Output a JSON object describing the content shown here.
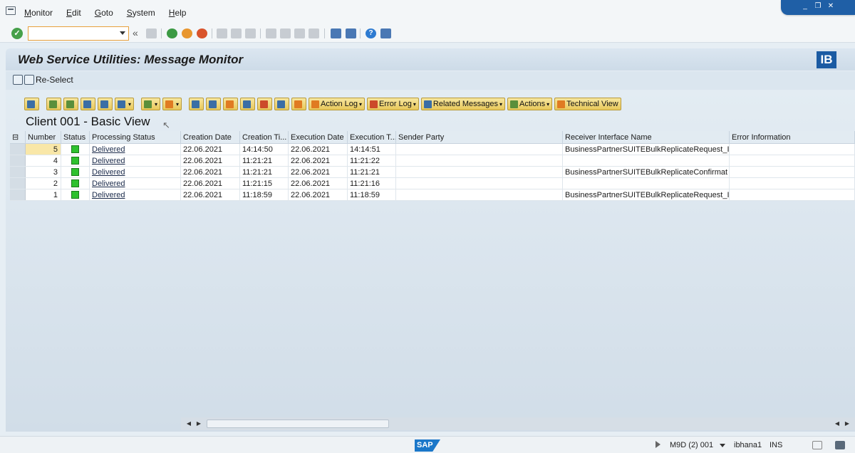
{
  "menu": {
    "items": [
      "Monitor",
      "Edit",
      "Goto",
      "System",
      "Help"
    ]
  },
  "window_controls": [
    "_",
    "❐",
    "✕"
  ],
  "toolbar": {
    "command_value": "",
    "back_glyph": "«"
  },
  "page": {
    "title": "Web Service Utilities: Message Monitor",
    "logo_text": "IB"
  },
  "app_toolbar": {
    "reselect_label": "Re-Select"
  },
  "alv_toolbar": {
    "action_log": "Action Log",
    "error_log": "Error Log",
    "related_messages": "Related Messages",
    "actions": "Actions",
    "technical_view": "Technical View"
  },
  "grid": {
    "title": "Client 001 - Basic View",
    "columns": [
      "Number",
      "Status",
      "Processing Status",
      "Creation Date",
      "Creation Ti...",
      "Execution Date",
      "Execution T...",
      "Sender Party",
      "Receiver Interface Name",
      "Error Information"
    ],
    "rows": [
      {
        "number": "5",
        "processing_status": "Delivered",
        "creation_date": "22.06.2021",
        "creation_time": "14:14:50",
        "execution_date": "22.06.2021",
        "execution_time": "14:14:51",
        "sender_party": "",
        "receiver_interface": "BusinessPartnerSUITEBulkReplicateRequest_In",
        "error_information": ""
      },
      {
        "number": "4",
        "processing_status": "Delivered",
        "creation_date": "22.06.2021",
        "creation_time": "11:21:21",
        "execution_date": "22.06.2021",
        "execution_time": "11:21:22",
        "sender_party": "",
        "receiver_interface": "",
        "error_information": ""
      },
      {
        "number": "3",
        "processing_status": "Delivered",
        "creation_date": "22.06.2021",
        "creation_time": "11:21:21",
        "execution_date": "22.06.2021",
        "execution_time": "11:21:21",
        "sender_party": "",
        "receiver_interface": "BusinessPartnerSUITEBulkReplicateConfirmat",
        "error_information": ""
      },
      {
        "number": "2",
        "processing_status": "Delivered",
        "creation_date": "22.06.2021",
        "creation_time": "11:21:15",
        "execution_date": "22.06.2021",
        "execution_time": "11:21:16",
        "sender_party": "",
        "receiver_interface": "",
        "error_information": ""
      },
      {
        "number": "1",
        "processing_status": "Delivered",
        "creation_date": "22.06.2021",
        "creation_time": "11:18:59",
        "execution_date": "22.06.2021",
        "execution_time": "11:18:59",
        "sender_party": "",
        "receiver_interface": "BusinessPartnerSUITEBulkReplicateRequest_In",
        "error_information": ""
      }
    ],
    "status_color": "#2ec12e"
  },
  "statusbar": {
    "logo_text": "SAP",
    "system": "M9D (2) 001",
    "user": "ibhana1",
    "mode": "INS"
  }
}
